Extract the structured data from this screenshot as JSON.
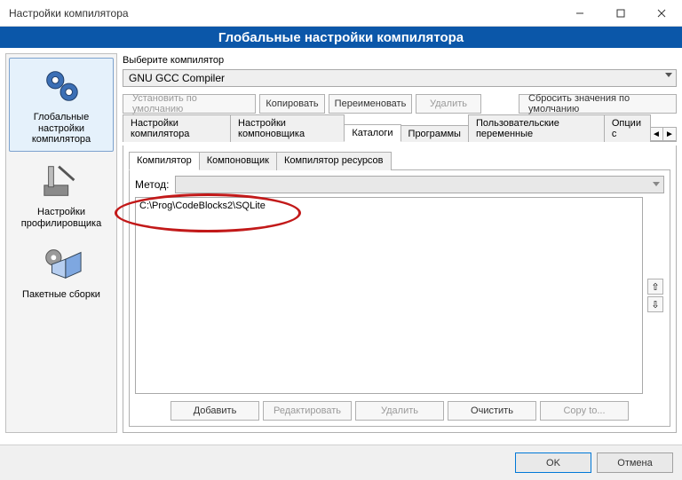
{
  "window": {
    "title": "Настройки компилятора"
  },
  "header": {
    "title": "Глобальные настройки компилятора"
  },
  "sidebar": {
    "items": [
      {
        "label": "Глобальные настройки компилятора"
      },
      {
        "label": "Настройки профилировщика"
      },
      {
        "label": "Пакетные сборки"
      }
    ]
  },
  "compiler": {
    "label": "Выберите компилятор",
    "selected": "GNU GCC Compiler"
  },
  "buttons_row1": {
    "set_default": "Установить по умолчанию",
    "copy": "Копировать",
    "rename": "Переименовать",
    "delete": "Удалить",
    "reset_defaults": "Сбросить значения по умолчанию"
  },
  "tabs_top": [
    "Настройки компилятора",
    "Настройки компоновщика",
    "Каталоги",
    "Программы",
    "Пользовательские переменные",
    "Опции с"
  ],
  "subtabs": [
    "Компилятор",
    "Компоновщик",
    "Компилятор ресурсов"
  ],
  "method_label": "Метод:",
  "dir_list": [
    "C:\\Prog\\CodeBlocks2\\SQLite"
  ],
  "action_buttons": {
    "add": "Добавить",
    "edit": "Редактировать",
    "delete": "Удалить",
    "clear": "Очистить",
    "copy_to": "Copy to..."
  },
  "dialog_buttons": {
    "ok": "OK",
    "cancel": "Отмена"
  }
}
